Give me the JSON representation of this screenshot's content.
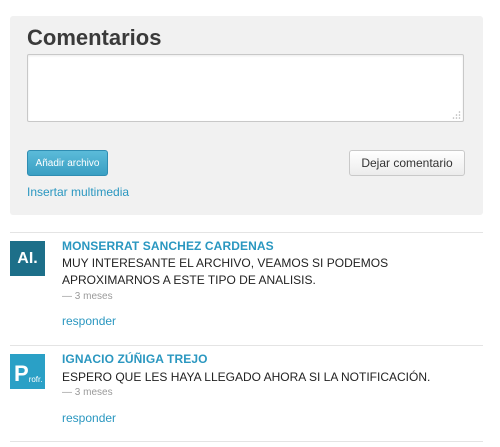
{
  "comments_panel": {
    "title": "Comentarios",
    "attach_button": "Añadir archivo",
    "leave_button": "Dejar comentario",
    "media_link": "Insertar multimedia"
  },
  "comments": [
    {
      "avatar_text": "AI.",
      "avatar_color": "#1d6f89",
      "author": "MONSERRAT SANCHEZ CARDENAS",
      "text": "MUY INTERESANTE EL ARCHIVO, VEAMOS SI PODEMOS APROXIMARNOS A ESTE TIPO DE ANALISIS.",
      "time": "— 3 meses",
      "reply": "responder"
    },
    {
      "avatar_text": "P",
      "avatar_subtext": "rofr.",
      "avatar_color": "#2aa0c6",
      "author": "IGNACIO ZÚÑIGA TREJO",
      "text": "ESPERO QUE LES HAYA LLEGADO AHORA SI LA NOTIFICACIÓN.",
      "time": "— 3 meses",
      "reply": "responder"
    }
  ]
}
